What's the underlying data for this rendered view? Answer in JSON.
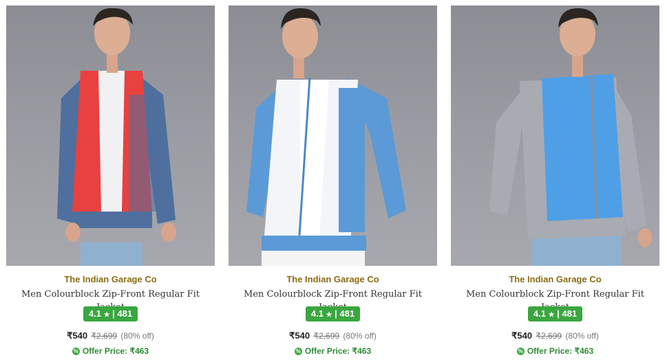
{
  "products": [
    {
      "brand": "The Indian Garage Co",
      "name": "Men Colourblock Zip-Front Regular Fit Jacket",
      "rating": "4.1",
      "rating_count": "481",
      "price": "₹540",
      "mrp": "₹2,699",
      "discount": "(80% off)",
      "offer_label": "Offer Price: ₹463",
      "colors": {
        "body": "#e8413f",
        "sleeve": "#4f6f9e",
        "band": "#4f6f9e"
      }
    },
    {
      "brand": "The Indian Garage Co",
      "name": "Men Colourblock Zip-Front Regular Fit Jacket",
      "rating": "4.1",
      "rating_count": "481",
      "price": "₹540",
      "mrp": "₹2,699",
      "discount": "(80% off)",
      "offer_label": "Offer Price: ₹463",
      "colors": {
        "body": "#f3f5f8",
        "sleeve": "#5b9ad6",
        "band": "#5b9ad6"
      }
    },
    {
      "brand": "The Indian Garage Co",
      "name": "Men Colourblock Zip-Front Regular Fit Jacket",
      "rating": "4.1",
      "rating_count": "481",
      "price": "₹540",
      "mrp": "₹2,699",
      "discount": "(80% off)",
      "offer_label": "Offer Price: ₹463",
      "colors": {
        "body": "#4f9fe6",
        "sleeve": "#a9abb2",
        "band": "#a9abb2"
      }
    }
  ],
  "icons": {
    "star": "star-icon",
    "offer": "offer-tag-icon"
  }
}
